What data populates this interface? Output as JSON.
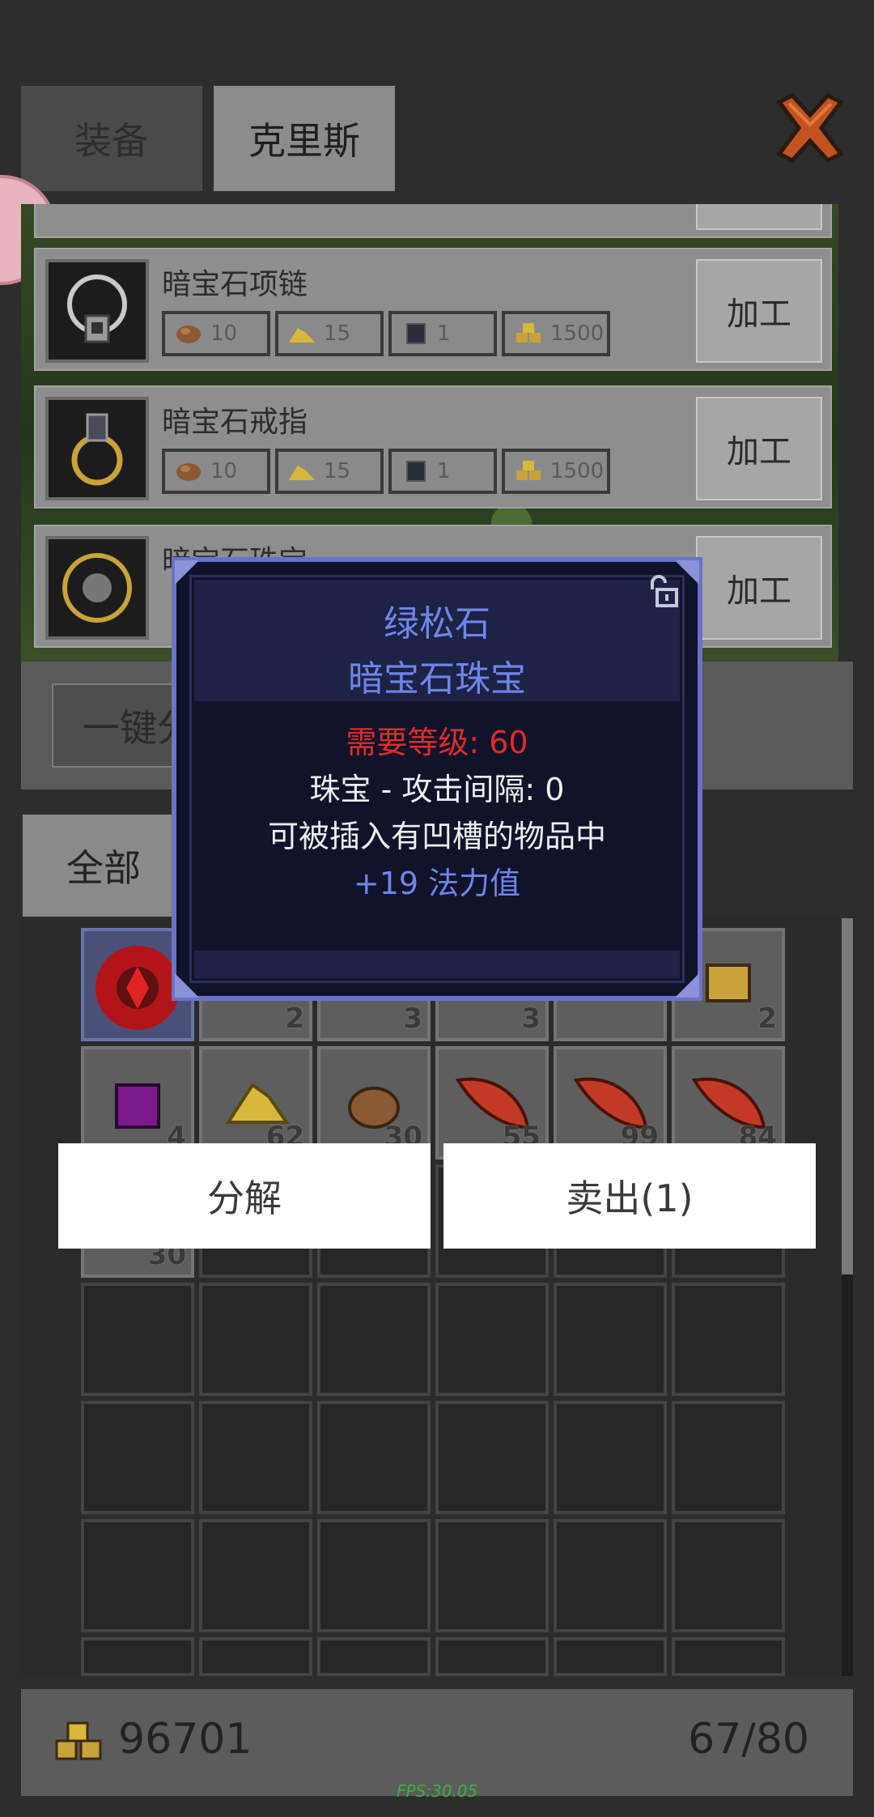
{
  "tabs": {
    "equip": "装备",
    "chris": "克里斯"
  },
  "recipes": [
    {
      "name": "暗宝石项链",
      "mats": [
        "10",
        "15",
        "1",
        "1500"
      ],
      "button": "加工"
    },
    {
      "name": "暗宝石戒指",
      "mats": [
        "10",
        "15",
        "1",
        "1500"
      ],
      "button": "加工"
    },
    {
      "name": "暗宝石珠宝",
      "button": "加工"
    }
  ],
  "one_key": "一键分",
  "inventory_tab": "全部",
  "inventory": {
    "row1_counts": [
      "2",
      "3",
      "3",
      "2"
    ],
    "row2_counts": [
      "4",
      "62",
      "30",
      "55",
      "99",
      "84"
    ],
    "row3_counts": [
      "30"
    ]
  },
  "tooltip": {
    "name": "绿松石",
    "type": "暗宝石珠宝",
    "requirement": "需要等级: 60",
    "stat": "珠宝 - 攻击间隔: 0",
    "socket": "可被插入有凹槽的物品中",
    "bonus": "+19 法力值"
  },
  "actions": {
    "decompose": "分解",
    "sell": "卖出(1)"
  },
  "footer": {
    "gold": "96701",
    "slots": "67/80"
  },
  "fps": "FPS:30.05",
  "icons": [
    "close-x-icon",
    "ore-icon",
    "gold-dust-icon",
    "dark-gem-icon",
    "coin-stack-icon",
    "lock-icon"
  ]
}
